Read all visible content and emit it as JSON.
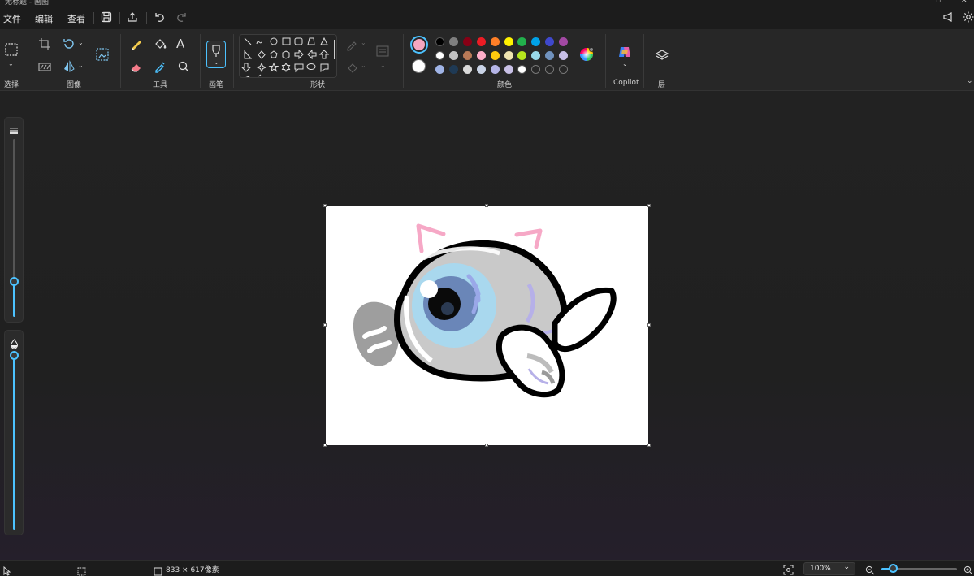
{
  "window": {
    "title": "无标题 - 画图"
  },
  "menu": {
    "file": "文件",
    "edit": "编辑",
    "view": "查看"
  },
  "ribbon": {
    "groups": {
      "select": "选择",
      "image": "图像",
      "tools": "工具",
      "brush": "画笔",
      "shapes": "形状",
      "colors": "颜色",
      "copilot": "Copilot",
      "layers": "层"
    },
    "primary_color": "#f4a7c0",
    "secondary_color": "#ffffff",
    "palette": [
      [
        "#000000",
        "#7f7f7f",
        "#880015",
        "#ed1c24",
        "#ff7f27",
        "#fff200",
        "#22b14c",
        "#00a2e8",
        "#3f48cc",
        "#a349a4"
      ],
      [
        "#ffffff",
        "#c3c3c3",
        "#b97a57",
        "#ffaec9",
        "#ffc90e",
        "#efe4b0",
        "#b5e61d",
        "#99d9ea",
        "#7092be",
        "#c8bfe7"
      ],
      [
        "#a0b4e6",
        "#1f3a55",
        "#d9d9d9",
        "#c9d3e6",
        "#b4b4e6",
        "#c8c0e6",
        "#ffffff",
        "empty",
        "empty",
        "empty"
      ]
    ]
  },
  "status": {
    "canvas_size": "833 × 617像素",
    "zoom": "100%"
  },
  "sliders": {
    "size_level": 0.2,
    "opacity_level": 1.0
  }
}
